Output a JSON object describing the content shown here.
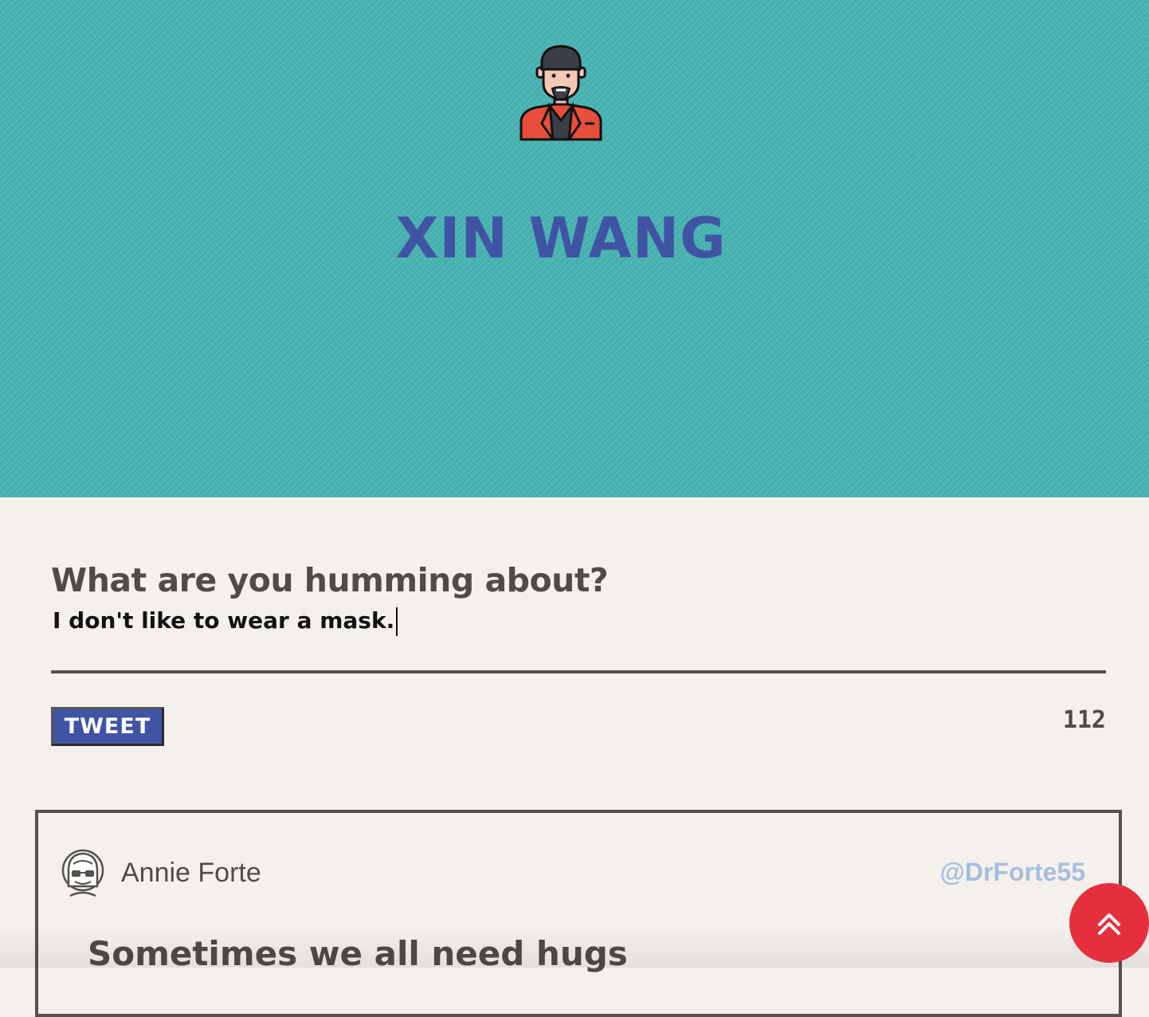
{
  "profile": {
    "name": "XIN WANG",
    "avatar_icon": "man-avatar-icon"
  },
  "compose": {
    "prompt": "What are you humming about?",
    "value": "I don't like to wear a mask.",
    "button_label": "TWEET",
    "char_count": "112"
  },
  "feed": [
    {
      "author_name": "Annie Forte",
      "handle": "@DrForte55",
      "avatar_icon": "woman-avatar-icon",
      "text": "Sometimes we all need hugs"
    }
  ],
  "scroll_top": {
    "icon": "double-chevron-up-icon"
  },
  "colors": {
    "hero_bg": "#45b3b3",
    "brand_blue": "#3f55a4",
    "page_bg": "#f4f1ec",
    "text_dark": "#4f4b47",
    "handle": "#a6bde0",
    "scroll_button": "#e52f3e",
    "avatar_jacket": "#e84e3c"
  }
}
